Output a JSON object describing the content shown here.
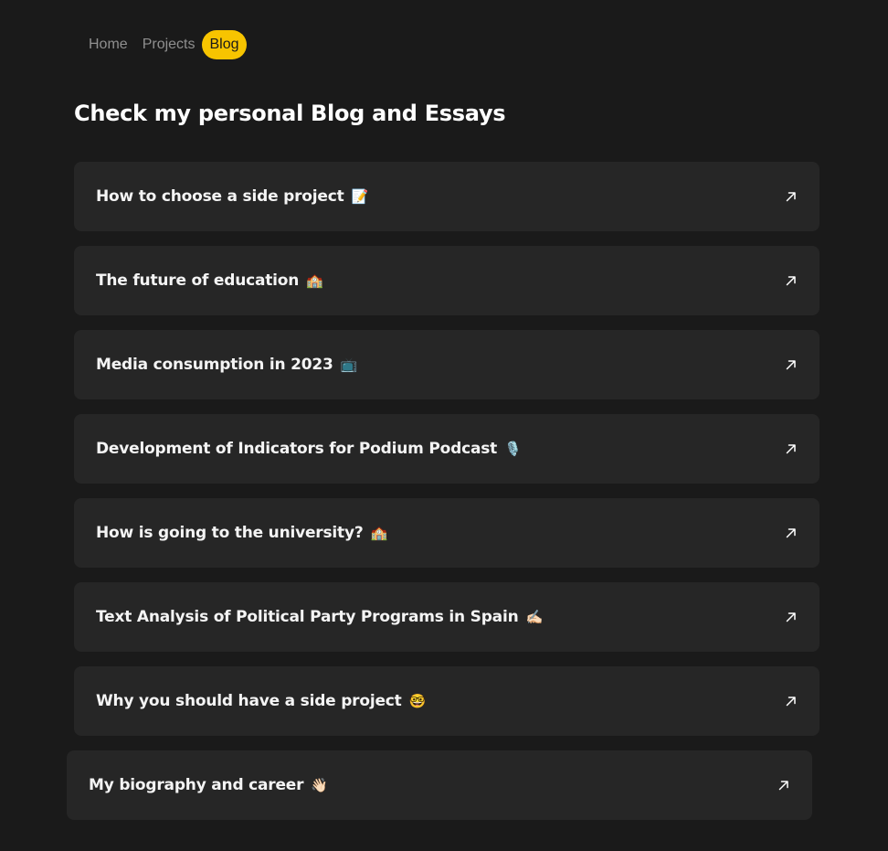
{
  "nav": {
    "items": [
      {
        "label": "Home",
        "active": false
      },
      {
        "label": "Projects",
        "active": false
      },
      {
        "label": "Blog",
        "active": true
      }
    ]
  },
  "page": {
    "title": "Check my personal Blog and Essays"
  },
  "posts": [
    {
      "title": "How to choose a side project",
      "emoji": "📝",
      "icon": "arrow-up-right-icon"
    },
    {
      "title": "The future of education",
      "emoji": "🏫",
      "icon": "arrow-up-right-icon"
    },
    {
      "title": "Media consumption in 2023",
      "emoji": "📺",
      "icon": "arrow-up-right-icon"
    },
    {
      "title": "Development of Indicators for Podium Podcast",
      "emoji": "🎙️",
      "icon": "arrow-up-right-icon"
    },
    {
      "title": "How is going to the university?",
      "emoji": "🏫",
      "icon": "arrow-up-right-icon"
    },
    {
      "title": "Text Analysis of Political Party Programs in Spain",
      "emoji": "✍🏻",
      "icon": "arrow-up-right-icon"
    },
    {
      "title": "Why you should have a side project",
      "emoji": "🤓",
      "icon": "arrow-up-right-icon"
    },
    {
      "title": "My biography and career",
      "emoji": "👋🏻",
      "icon": "arrow-up-right-icon"
    }
  ],
  "colors": {
    "background": "#1a1a1a",
    "card": "#262626",
    "accent": "#f7c400",
    "nav_text": "#8f8f8f"
  }
}
